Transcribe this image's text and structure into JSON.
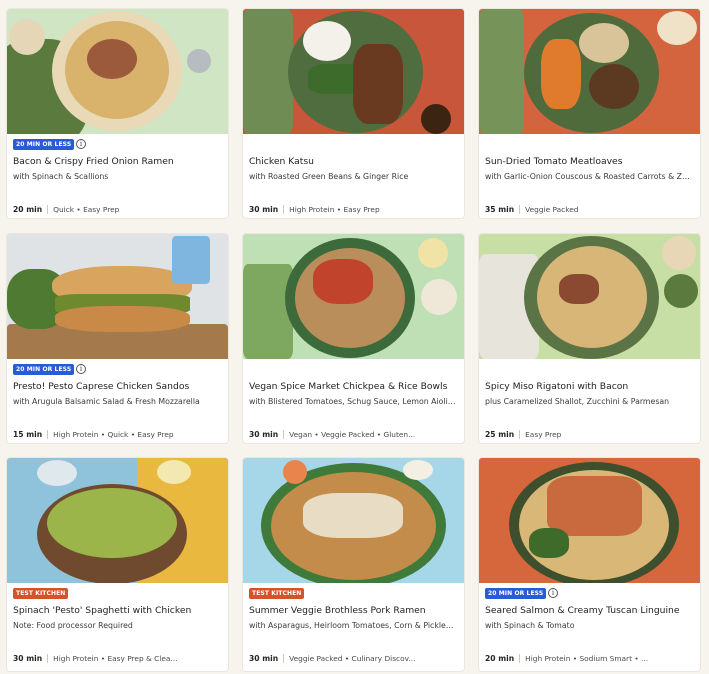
{
  "cards": [
    {
      "badge": "20 MIN OR LESS",
      "badge_color": "#2a5bd7",
      "title": "Bacon & Crispy Fried Onion Ramen",
      "subtitle": "with Spinach & Scallions",
      "time": "20 min",
      "tags": "Quick • Easy Prep"
    },
    {
      "badge": "",
      "title": "Chicken Katsu",
      "subtitle": "with Roasted Green Beans & Ginger Rice",
      "time": "30 min",
      "tags": "High Protein • Easy Prep"
    },
    {
      "badge": "",
      "title": "Sun-Dried Tomato Meatloaves",
      "subtitle": "with Garlic-Onion Couscous & Roasted Carrots & Zu...",
      "time": "35 min",
      "tags": "Veggie Packed"
    },
    {
      "badge": "20 MIN OR LESS",
      "badge_color": "#2a5bd7",
      "title": "Presto! Pesto Caprese Chicken Sandos",
      "subtitle": "with Arugula Balsamic Salad & Fresh Mozzarella",
      "time": "15 min",
      "tags": "High Protein • Quick • Easy Prep"
    },
    {
      "badge": "",
      "title": "Vegan Spice Market Chickpea & Rice Bowls",
      "subtitle": "with Blistered Tomatoes, Schug Sauce, Lemon Aioli ...",
      "time": "30 min",
      "tags": "Vegan • Veggie Packed • Gluten..."
    },
    {
      "badge": "",
      "title": "Spicy Miso Rigatoni with Bacon",
      "subtitle": "plus Caramelized Shallot, Zucchini & Parmesan",
      "time": "25 min",
      "tags": "Easy Prep"
    },
    {
      "badge": "TEST KITCHEN",
      "badge_color": "#d4532b",
      "title": "Spinach 'Pesto' Spaghetti with Chicken",
      "subtitle": "Note: Food processor Required",
      "time": "30 min",
      "tags": "High Protein • Easy Prep & Clea..."
    },
    {
      "badge": "TEST KITCHEN",
      "badge_color": "#d4532b",
      "title": "Summer Veggie Brothless Pork Ramen",
      "subtitle": "with Asparagus, Heirloom Tomatoes, Corn & Pickled...",
      "time": "30 min",
      "tags": "Veggie Packed • Culinary Discov..."
    },
    {
      "badge": "20 MIN OR LESS",
      "badge_color": "#2a5bd7",
      "title": "Seared Salmon & Creamy Tuscan Linguine",
      "subtitle": "with Spinach & Tomato",
      "time": "20 min",
      "tags": "High Protein • Sodium Smart • ..."
    }
  ],
  "info_icon": "info-icon",
  "colors": {
    "page_background": "#f7f4ee",
    "blue_badge": "#2a5bd7",
    "orange_badge": "#d4532b"
  }
}
